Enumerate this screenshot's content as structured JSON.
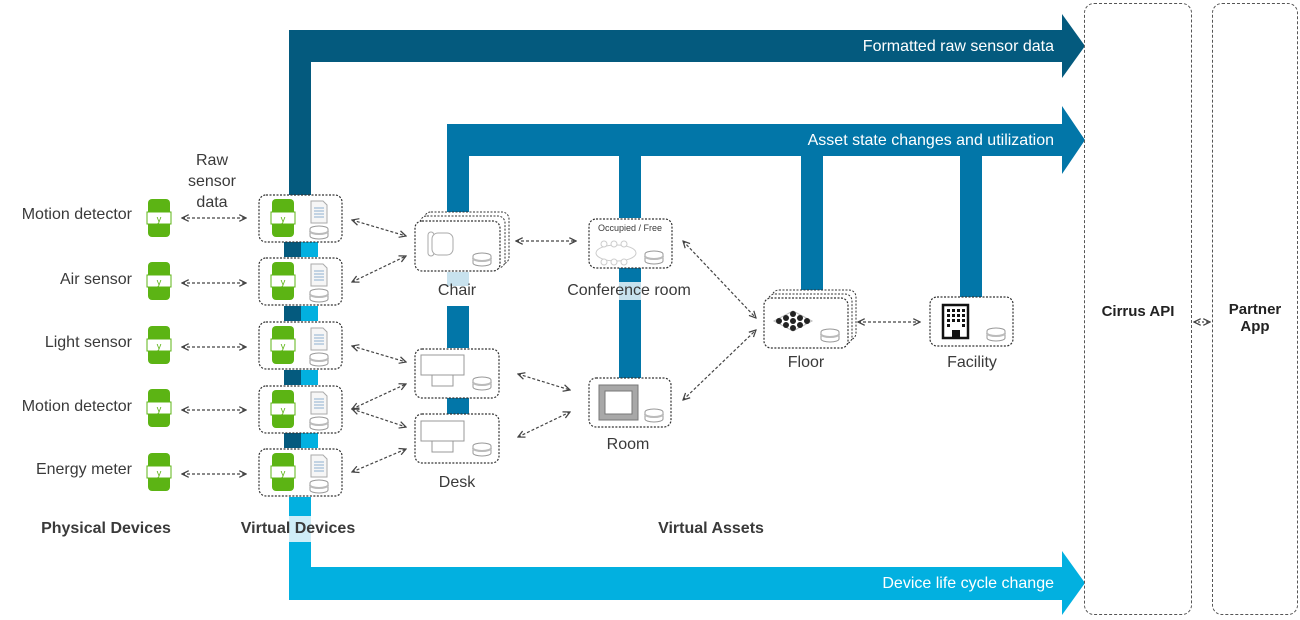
{
  "colors": {
    "raw_flow": "#045a7e",
    "asset_flow": "#0276a8",
    "lifecycle_flow": "#02b0e0",
    "device_green": "#5cb414",
    "text": "#3a3a3a"
  },
  "flows": {
    "raw": "Formatted raw sensor data",
    "asset": "Asset state changes and utilization",
    "lifecycle": "Device life cycle change"
  },
  "physical_devices": {
    "heading": "Physical Devices",
    "connector_label": "Raw sensor data",
    "items": [
      {
        "label": "Motion detector",
        "icon": "sensor-icon"
      },
      {
        "label": "Air sensor",
        "icon": "sensor-icon"
      },
      {
        "label": "Light sensor",
        "icon": "sensor-icon"
      },
      {
        "label": "Motion detector",
        "icon": "sensor-icon"
      },
      {
        "label": "Energy meter",
        "icon": "sensor-icon"
      }
    ]
  },
  "virtual_devices": {
    "heading": "Virtual Devices"
  },
  "virtual_assets": {
    "heading": "Virtual Assets",
    "chair": "Chair",
    "conference_room": "Conference room",
    "conference_status": "Occupied / Free",
    "desk": "Desk",
    "room": "Room",
    "floor": "Floor",
    "facility": "Facility"
  },
  "endpoints": {
    "api": "Cirrus API",
    "partner_line1": "Partner",
    "partner_line2": "App"
  }
}
